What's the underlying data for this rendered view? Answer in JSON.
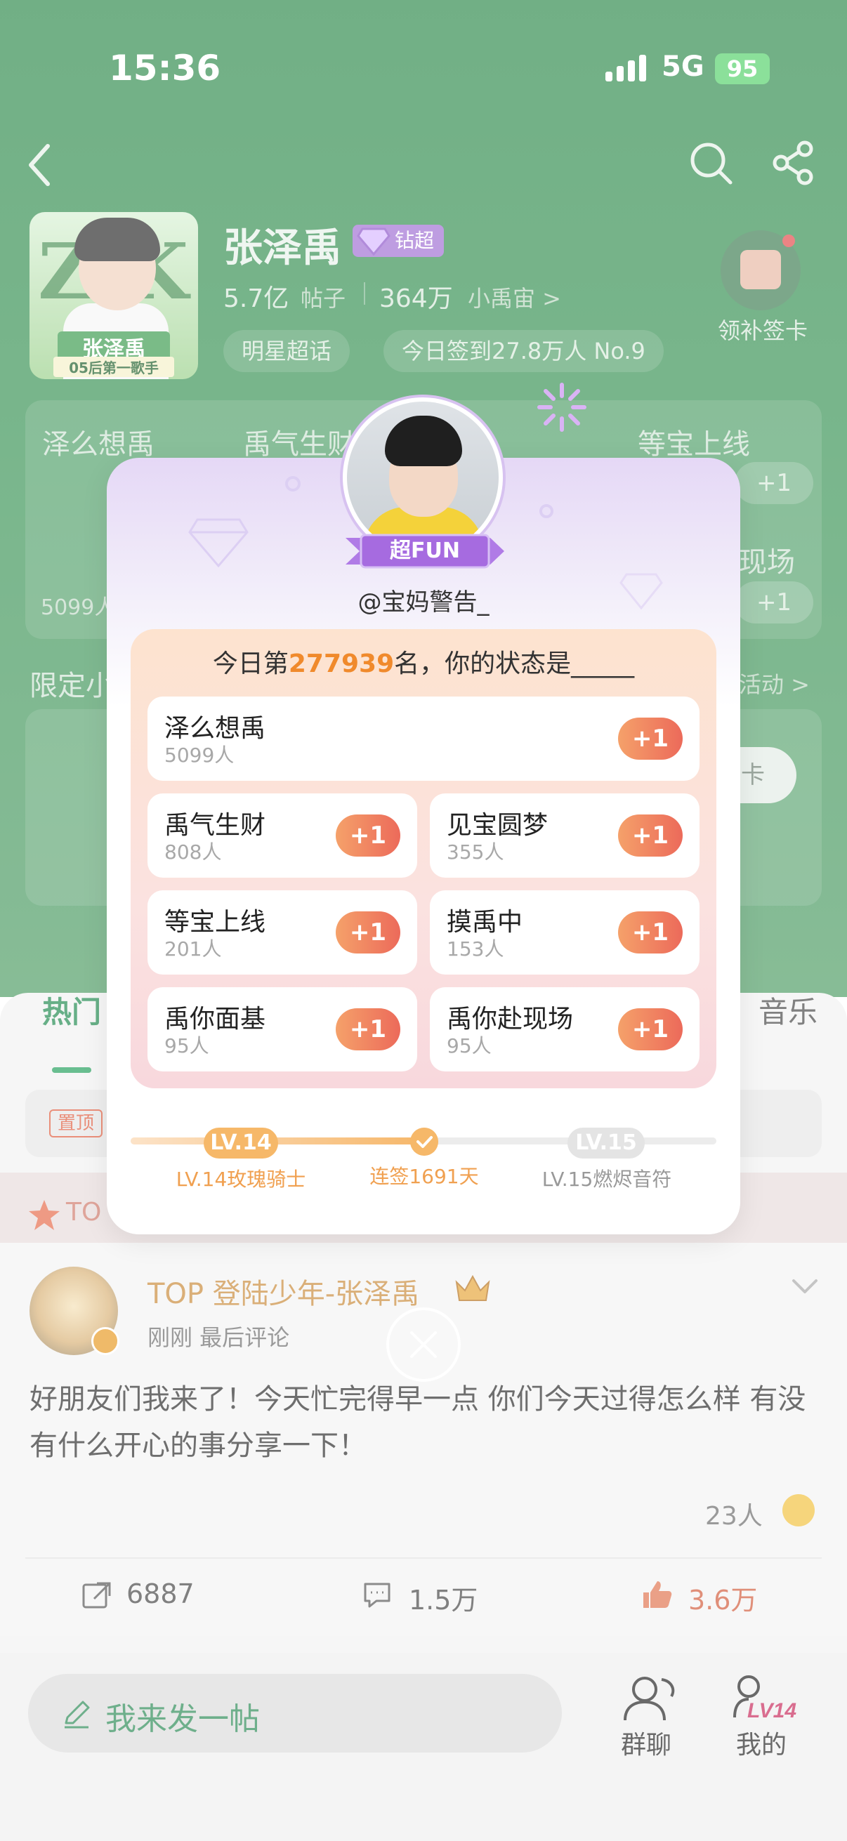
{
  "status_bar": {
    "time": "15:36",
    "network": "5G",
    "battery": "95"
  },
  "header": {
    "star_name": "张泽禹",
    "badge_label": "钻超",
    "posts_count": "5.7亿",
    "posts_label": "帖子",
    "fans_count": "364万",
    "fans_label": "小禹宙 >",
    "tag_star": "明星超话",
    "tag_checkin": "今日签到27.8万人 No.9",
    "calendar_label": "领补签卡",
    "cover_label_1": "张泽禹",
    "cover_label_2": "05后第一歌手"
  },
  "hot_section": {
    "titles": [
      "泽么想禹",
      "禹气生财",
      "等宝上线",
      "现场"
    ],
    "count": "5099人",
    "plus_label": "+1"
  },
  "limited_section": {
    "title": "限定小",
    "more": "活动 >",
    "button": "卡"
  },
  "feed": {
    "tab_hot": "热门",
    "tab_music": "音乐",
    "pin_badge": "置顶",
    "top_label": "TO",
    "post": {
      "author": "TOP 登陆少年-张泽禹",
      "meta": "刚刚 最后评论",
      "body": "好朋友们我来了！今天忙完得早一点 你们今天过得怎么样 有没有什么开心的事分享一下！",
      "reactions": "23人",
      "reposts": "6887",
      "comments": "1.5万",
      "likes": "3.6万"
    }
  },
  "bottom_bar": {
    "compose_placeholder": "我来发一帖",
    "group_label": "群聊",
    "mine_label": "我的",
    "mine_level": "LV14"
  },
  "modal": {
    "superfun_label": "超FUN",
    "username": "@宝妈警告_",
    "rank_prefix": "今日第",
    "rank_number": "277939",
    "rank_suffix": "名，你的状态是_____",
    "plus_label": "+1",
    "options": [
      {
        "name": "泽么想禹",
        "count": "5099人"
      },
      {
        "name": "禹气生财",
        "count": "808人"
      },
      {
        "name": "见宝圆梦",
        "count": "355人"
      },
      {
        "name": "等宝上线",
        "count": "201人"
      },
      {
        "name": "摸禹中",
        "count": "153人"
      },
      {
        "name": "禹你面基",
        "count": "95人"
      },
      {
        "name": "禹你赴现场",
        "count": "95人"
      }
    ],
    "level": {
      "current_badge": "LV.14",
      "next_badge": "LV.15",
      "current_label": "LV.14玫瑰骑士",
      "next_label": "LV.15燃烬音符",
      "streak_label": "连签1691天",
      "progress": 0.5
    }
  },
  "colors": {
    "header_green": "#2f8a4c",
    "accent_orange": "#f08a2c",
    "plus_gradient_start": "#f5a16a",
    "plus_gradient_end": "#ec6a5a",
    "purple": "#a06fd3"
  }
}
